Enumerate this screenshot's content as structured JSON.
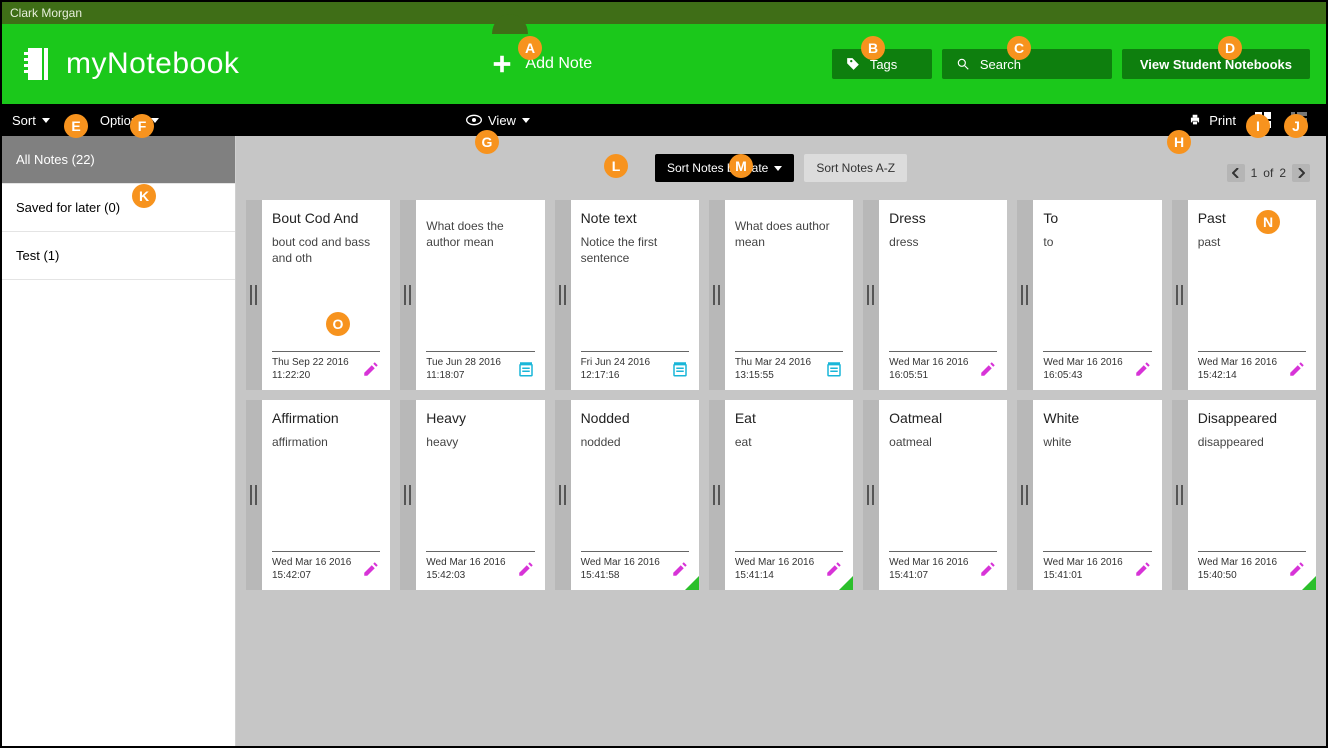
{
  "user": {
    "name": "Clark Morgan"
  },
  "header": {
    "app_name": "myNotebook",
    "add_note_label": "Add Note",
    "tags_label": "Tags",
    "search_label": "Search",
    "view_notebooks_label": "View Student Notebooks"
  },
  "toolbar": {
    "sort_label": "Sort",
    "options_label": "Options",
    "view_label": "View",
    "print_label": "Print"
  },
  "sidebar": {
    "items": [
      {
        "label": "All Notes (22)",
        "active": true
      },
      {
        "label": "Saved for later (0)",
        "active": false
      },
      {
        "label": "Test (1)",
        "active": false
      }
    ]
  },
  "sort_controls": {
    "by_date": "Sort Notes by Date",
    "a_z": "Sort Notes A-Z"
  },
  "pager": {
    "current": "1",
    "of_label": "of",
    "total": "2"
  },
  "notes": [
    {
      "title": "Bout Cod And",
      "snippet": "bout cod and bass and oth",
      "date1": "Thu Sep 22 2016",
      "date2": "11:22:20",
      "icon": "pencil",
      "corner": false
    },
    {
      "title": "",
      "snippet": "What does the author mean",
      "date1": "Tue Jun 28 2016",
      "date2": "11:18:07",
      "icon": "doc",
      "corner": false
    },
    {
      "title": "Note text",
      "snippet": "Notice the first sentence",
      "date1": "Fri Jun 24 2016",
      "date2": "12:17:16",
      "icon": "doc",
      "corner": false
    },
    {
      "title": "",
      "snippet": "What does author mean",
      "date1": "Thu Mar 24 2016",
      "date2": "13:15:55",
      "icon": "doc",
      "corner": false
    },
    {
      "title": "Dress",
      "snippet": "dress",
      "date1": "Wed Mar 16 2016",
      "date2": "16:05:51",
      "icon": "pencil",
      "corner": false
    },
    {
      "title": "To",
      "snippet": "to",
      "date1": "Wed Mar 16 2016",
      "date2": "16:05:43",
      "icon": "pencil",
      "corner": false
    },
    {
      "title": "Past",
      "snippet": "past",
      "date1": "Wed Mar 16 2016",
      "date2": "15:42:14",
      "icon": "pencil",
      "corner": false
    },
    {
      "title": "Affirmation",
      "snippet": "affirmation",
      "date1": "Wed Mar 16 2016",
      "date2": "15:42:07",
      "icon": "pencil",
      "corner": false
    },
    {
      "title": "Heavy",
      "snippet": "heavy",
      "date1": "Wed Mar 16 2016",
      "date2": "15:42:03",
      "icon": "pencil",
      "corner": false
    },
    {
      "title": "Nodded",
      "snippet": "nodded",
      "date1": "Wed Mar 16 2016",
      "date2": "15:41:58",
      "icon": "pencil",
      "corner": true
    },
    {
      "title": "Eat",
      "snippet": "eat",
      "date1": "Wed Mar 16 2016",
      "date2": "15:41:14",
      "icon": "pencil",
      "corner": true
    },
    {
      "title": "Oatmeal",
      "snippet": "oatmeal",
      "date1": "Wed Mar 16 2016",
      "date2": "15:41:07",
      "icon": "pencil",
      "corner": false
    },
    {
      "title": "White",
      "snippet": "white",
      "date1": "Wed Mar 16 2016",
      "date2": "15:41:01",
      "icon": "pencil",
      "corner": false
    },
    {
      "title": "Disappeared",
      "snippet": "disappeared",
      "date1": "Wed Mar 16 2016",
      "date2": "15:40:50",
      "icon": "pencil",
      "corner": true
    }
  ],
  "annotations": {
    "A": "A",
    "B": "B",
    "C": "C",
    "D": "D",
    "E": "E",
    "F": "F",
    "G": "G",
    "H": "H",
    "I": "I",
    "J": "J",
    "K": "K",
    "L": "L",
    "M": "M",
    "N": "N",
    "O": "O"
  }
}
